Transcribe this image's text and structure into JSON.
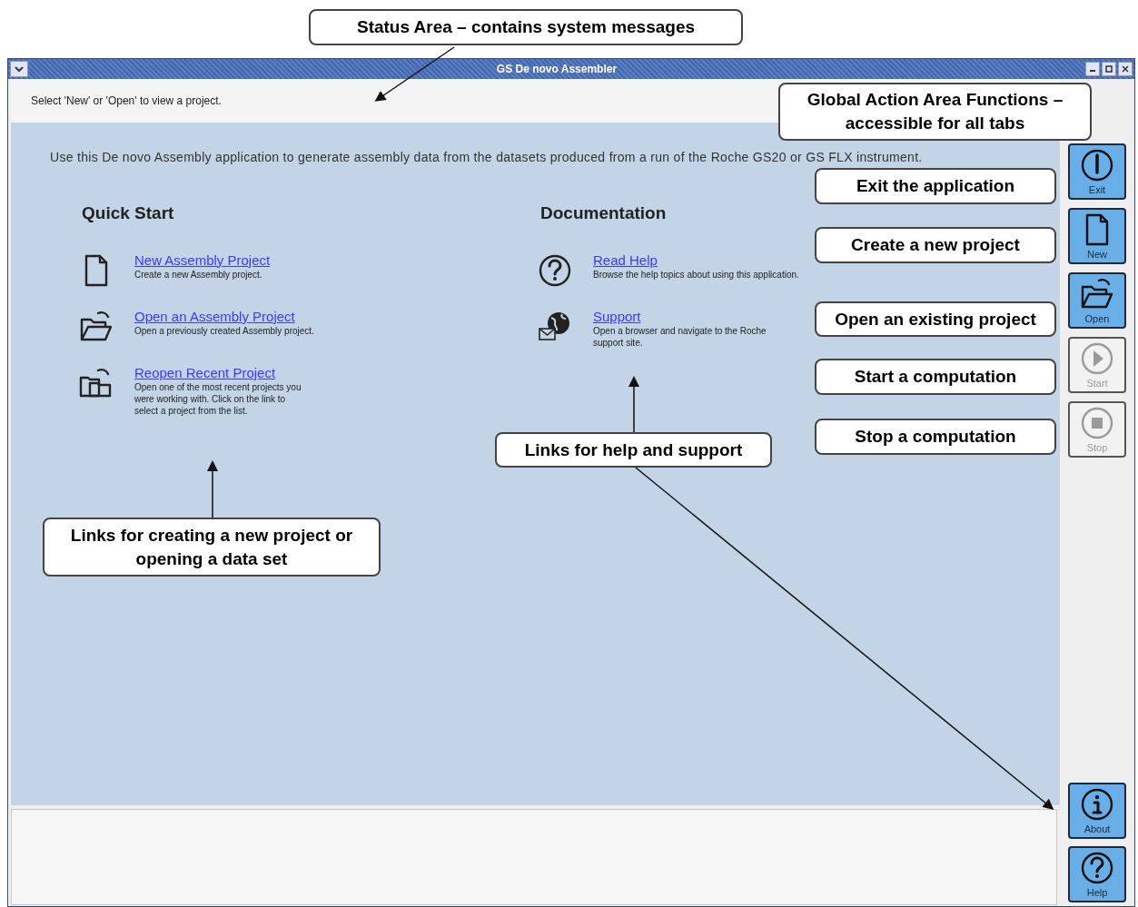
{
  "window": {
    "title": "GS De novo Assembler"
  },
  "status_area": {
    "message": "Select 'New' or 'Open' to view a project."
  },
  "intro": "Use this De novo Assembly application to generate assembly data from the datasets produced from a run of the Roche GS20 or GS FLX instrument.",
  "sections": [
    {
      "heading": "Quick Start",
      "items": [
        {
          "kind": "new",
          "link": "New Assembly Project",
          "description": "Create a new Assembly project."
        },
        {
          "kind": "open",
          "link": "Open an Assembly Project",
          "description": "Open a previously created Assembly project."
        },
        {
          "kind": "recent",
          "link": "Reopen Recent Project",
          "description": "Open one of the most recent projects you were working with. Click on the link to select a project from the list."
        }
      ]
    },
    {
      "heading": "Documentation",
      "items": [
        {
          "kind": "help",
          "link": "Read Help",
          "description": "Browse the help topics about using this application."
        },
        {
          "kind": "support",
          "link": "Support",
          "description": "Open a browser and navigate to the Roche support site."
        }
      ]
    }
  ],
  "toolbar": {
    "top": [
      {
        "kind": "exit",
        "label": "Exit",
        "disabled": false
      },
      {
        "kind": "new",
        "label": "New",
        "disabled": false
      },
      {
        "kind": "open",
        "label": "Open",
        "disabled": false
      },
      {
        "kind": "start",
        "label": "Start",
        "disabled": true
      },
      {
        "kind": "stop",
        "label": "Stop",
        "disabled": true
      }
    ],
    "bottom": [
      {
        "kind": "about",
        "label": "About",
        "disabled": false
      },
      {
        "kind": "help",
        "label": "Help",
        "disabled": false
      }
    ]
  },
  "callouts": [
    {
      "kind": "status",
      "text": "Status Area – contains system messages"
    },
    {
      "kind": "global",
      "text": "Global Action Area Functions – accessible for all tabs"
    },
    {
      "kind": "exit",
      "text": "Exit the application"
    },
    {
      "kind": "new",
      "text": "Create a new project"
    },
    {
      "kind": "open",
      "text": "Open an existing project"
    },
    {
      "kind": "start",
      "text": "Start a computation"
    },
    {
      "kind": "stop",
      "text": "Stop a computation"
    },
    {
      "kind": "help_links",
      "text": "Links for help and support"
    },
    {
      "kind": "project_links",
      "text": "Links for creating a new project or opening a data set"
    }
  ]
}
